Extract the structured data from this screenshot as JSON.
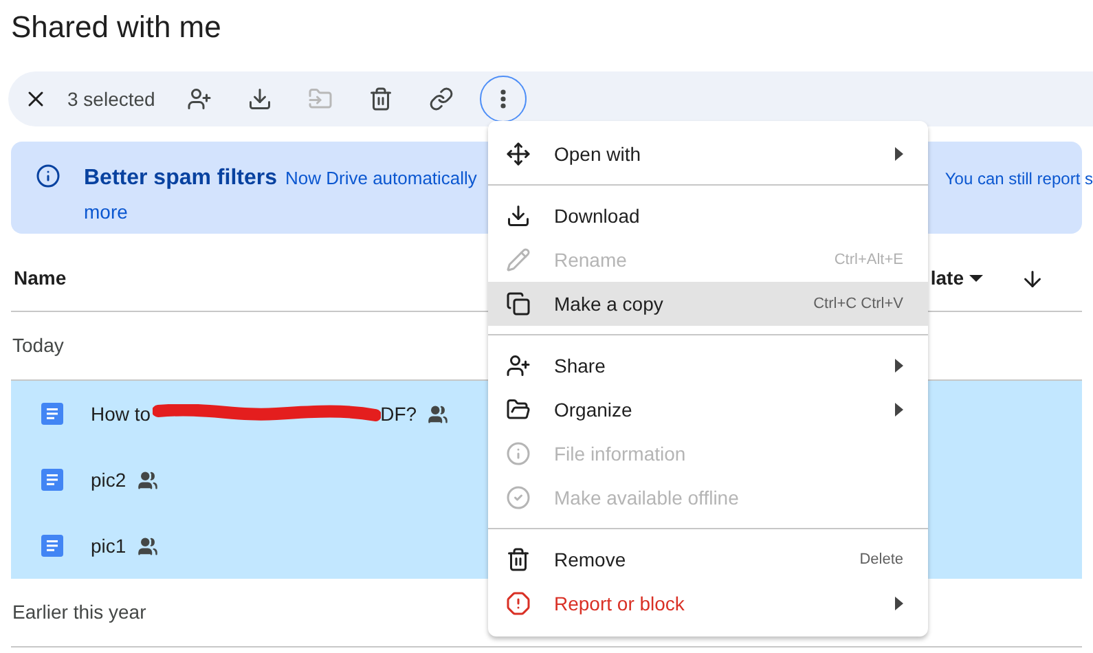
{
  "page_title": "Shared with me",
  "toolbar": {
    "selection_count": "3 selected",
    "actions": [
      {
        "disabled": false
      },
      {
        "disabled": false
      },
      {
        "disabled": true
      },
      {
        "disabled": false
      },
      {
        "disabled": false
      }
    ],
    "more_focused": true
  },
  "banner": {
    "title": "Better spam filters",
    "text": "Now Drive automatically",
    "text_tail": "You can still report s",
    "link": "more"
  },
  "table": {
    "columns": [
      {
        "label": "Name"
      },
      {
        "label": "late",
        "sort_caret": true
      }
    ],
    "sort_descending": true,
    "groups": [
      {
        "label": "Today",
        "rows": [
          {
            "name": "How to",
            "name_tail": "DF?",
            "redacted": true,
            "shared": true,
            "selected": true
          },
          {
            "name": "pic2",
            "shared": true,
            "selected": true,
            "redacted": false
          },
          {
            "name": "pic1",
            "shared": true,
            "selected": true,
            "redacted": false
          }
        ]
      },
      {
        "label": "Earlier this year"
      }
    ]
  },
  "menu": {
    "items": [
      {
        "kind": "item",
        "label": "Open with",
        "submenu": true,
        "disabled": false,
        "highlighted": false,
        "danger": false
      },
      {
        "kind": "divider"
      },
      {
        "kind": "item",
        "label": "Download",
        "submenu": false,
        "disabled": false,
        "highlighted": false,
        "danger": false
      },
      {
        "kind": "item",
        "label": "Rename",
        "shortcut": "Ctrl+Alt+E",
        "submenu": false,
        "disabled": true,
        "highlighted": false,
        "danger": false
      },
      {
        "kind": "item",
        "label": "Make a copy",
        "shortcut": "Ctrl+C Ctrl+V",
        "submenu": false,
        "disabled": false,
        "highlighted": true,
        "danger": false
      },
      {
        "kind": "divider"
      },
      {
        "kind": "item",
        "label": "Share",
        "submenu": true,
        "disabled": false,
        "highlighted": false,
        "danger": false
      },
      {
        "kind": "item",
        "label": "Organize",
        "submenu": true,
        "disabled": false,
        "highlighted": false,
        "danger": false
      },
      {
        "kind": "item",
        "label": "File information",
        "submenu": false,
        "disabled": true,
        "highlighted": false,
        "danger": false
      },
      {
        "kind": "item",
        "label": "Make available offline",
        "submenu": false,
        "disabled": true,
        "highlighted": false,
        "danger": false
      },
      {
        "kind": "divider"
      },
      {
        "kind": "item",
        "label": "Remove",
        "shortcut": "Delete",
        "submenu": false,
        "disabled": false,
        "highlighted": false,
        "danger": false
      },
      {
        "kind": "item",
        "label": "Report or block",
        "submenu": true,
        "disabled": false,
        "highlighted": false,
        "danger": true
      }
    ]
  }
}
